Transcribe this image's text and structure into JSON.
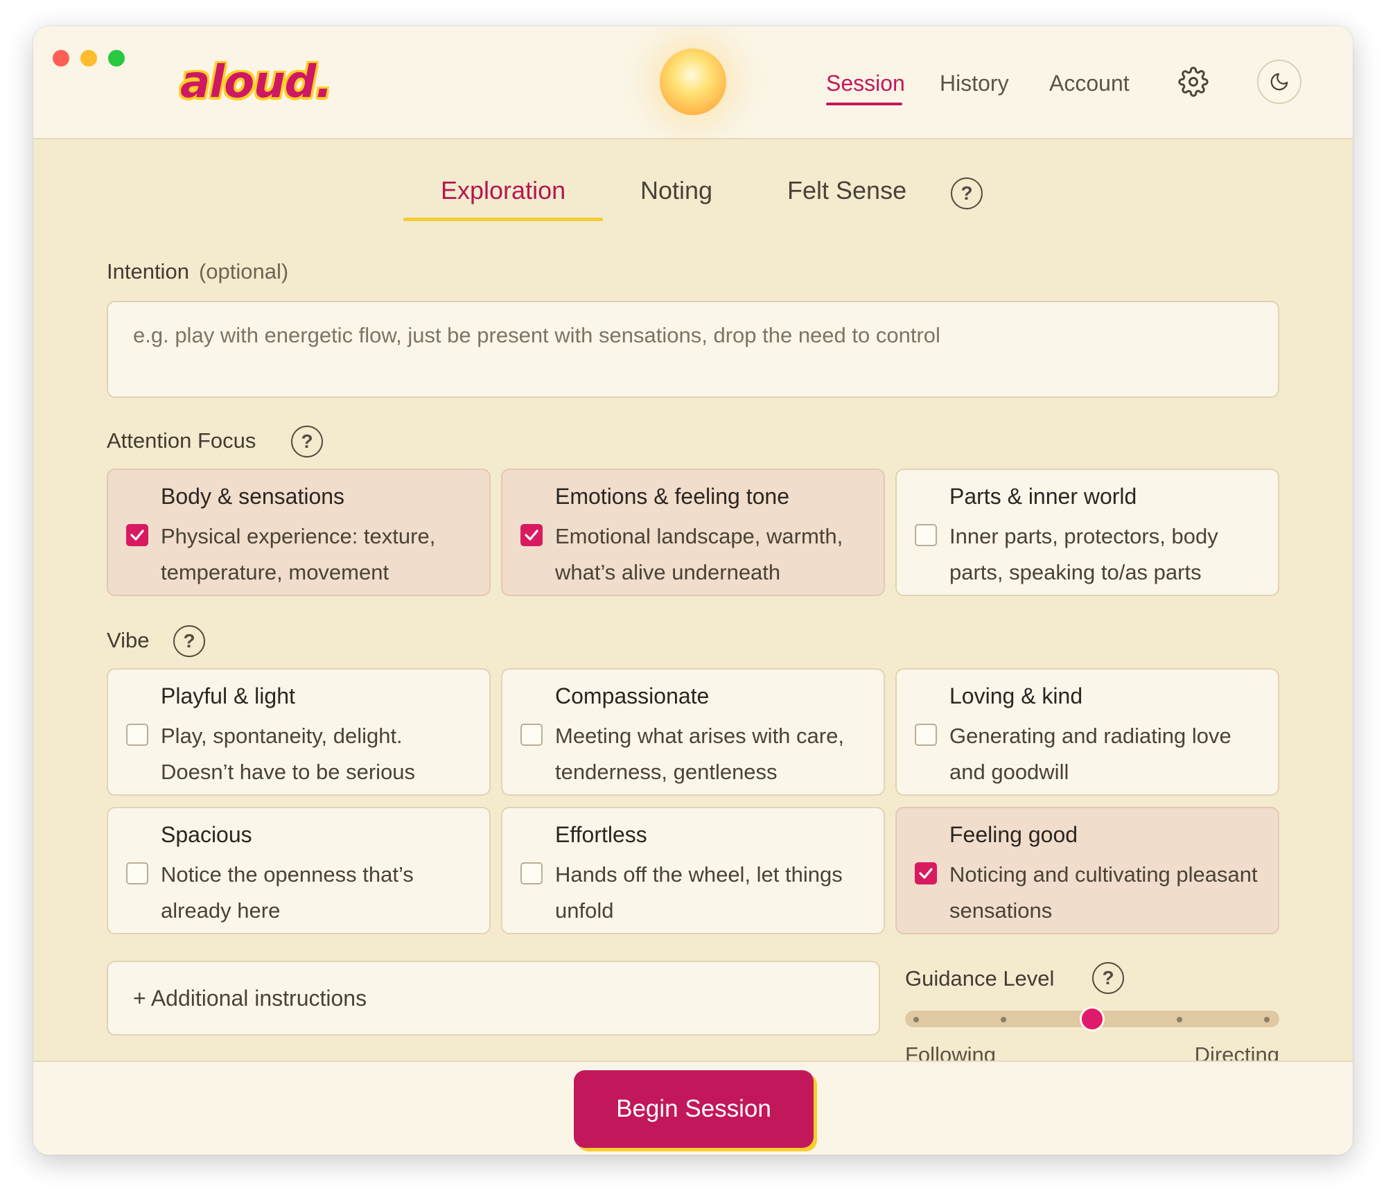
{
  "app": {
    "logo_text": "aloud."
  },
  "topnav": {
    "items": [
      {
        "label": "Session",
        "active": true
      },
      {
        "label": "History",
        "active": false
      },
      {
        "label": "Account",
        "active": false
      }
    ],
    "settings_icon": "gear-icon",
    "theme_icon": "moon-icon"
  },
  "tabs": [
    {
      "label": "Exploration",
      "active": true
    },
    {
      "label": "Noting",
      "active": false
    },
    {
      "label": "Felt Sense",
      "active": false
    }
  ],
  "intention": {
    "label": "Intention",
    "optional_label": "(optional)",
    "placeholder": "e.g. play with energetic flow, just be present with sensations, drop the need to control",
    "value": ""
  },
  "attention_focus": {
    "label": "Attention Focus",
    "options": [
      {
        "title": "Body & sensations",
        "description": "Physical experience: texture, temperature, movement",
        "checked": true
      },
      {
        "title": "Emotions & feeling tone",
        "description": "Emotional landscape, warmth, what’s alive underneath",
        "checked": true
      },
      {
        "title": "Parts & inner world",
        "description": "Inner parts, protectors, body parts, speaking to/as parts",
        "checked": false
      }
    ]
  },
  "vibe": {
    "label": "Vibe",
    "options": [
      {
        "title": "Playful & light",
        "description": "Play, spontaneity, delight. Doesn’t have to be serious",
        "checked": false
      },
      {
        "title": "Compassionate",
        "description": "Meeting what arises with care, tenderness, gentleness",
        "checked": false
      },
      {
        "title": "Loving & kind",
        "description": "Generating and radiating love and goodwill",
        "checked": false
      },
      {
        "title": "Spacious",
        "description": "Notice the openness that’s already here",
        "checked": false
      },
      {
        "title": "Effortless",
        "description": "Hands off the wheel, let things unfold",
        "checked": false
      },
      {
        "title": "Feeling good",
        "description": "Noticing and cultivating pleasant sensations",
        "checked": true
      }
    ]
  },
  "additional_instructions": {
    "label": "+ Additional instructions"
  },
  "guidance": {
    "label": "Guidance Level",
    "min_label": "Following",
    "max_label": "Directing",
    "steps": 5,
    "selected_step": 3,
    "value_fraction": 0.5
  },
  "footer": {
    "begin_label": "Begin Session"
  },
  "colors": {
    "accent": "#c2185b",
    "highlight": "#f2cd33",
    "checked_card": "#f1ddcb"
  }
}
